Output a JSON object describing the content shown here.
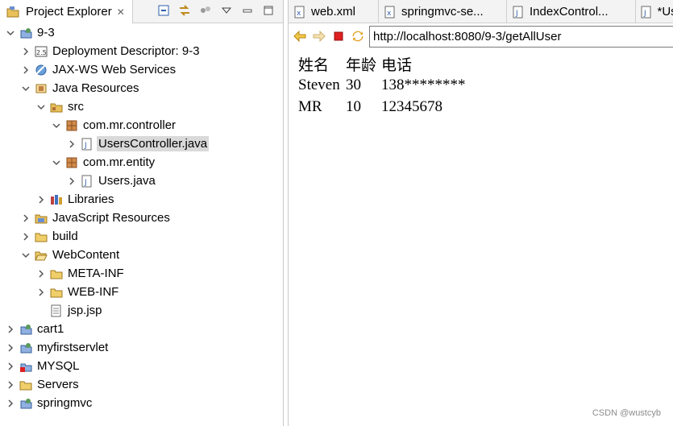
{
  "explorer": {
    "title": "Project Explorer",
    "close_glyph": "✕",
    "toolbar": [
      "collapse-all-icon",
      "link-with-editor-icon",
      "filter-icon",
      "view-menu-icon",
      "minimize-icon",
      "maximize-icon"
    ],
    "rows": [
      {
        "label": "9-3",
        "icon": "web-project-icon",
        "twisty": "expanded"
      },
      {
        "label": "Deployment Descriptor: 9-3",
        "icon": "deployment-descriptor-icon",
        "twisty": "collapsed"
      },
      {
        "label": "JAX-WS Web Services",
        "icon": "web-services-icon",
        "twisty": "collapsed"
      },
      {
        "label": "Java Resources",
        "icon": "java-resources-icon",
        "twisty": "expanded"
      },
      {
        "label": "src",
        "icon": "source-folder-icon",
        "twisty": "expanded"
      },
      {
        "label": "com.mr.controller",
        "icon": "package-icon",
        "twisty": "expanded"
      },
      {
        "label": "UsersController.java",
        "icon": "java-file-icon",
        "twisty": "collapsed",
        "selected": true
      },
      {
        "label": "com.mr.entity",
        "icon": "package-icon",
        "twisty": "expanded"
      },
      {
        "label": "Users.java",
        "icon": "java-file-icon",
        "twisty": "collapsed"
      },
      {
        "label": "Libraries",
        "icon": "libraries-icon",
        "twisty": "collapsed"
      },
      {
        "label": "JavaScript Resources",
        "icon": "javascript-resources-icon",
        "twisty": "collapsed"
      },
      {
        "label": "build",
        "icon": "folder-icon",
        "twisty": "collapsed"
      },
      {
        "label": "WebContent",
        "icon": "folder-open-icon",
        "twisty": "expanded"
      },
      {
        "label": "META-INF",
        "icon": "folder-icon",
        "twisty": "collapsed"
      },
      {
        "label": "WEB-INF",
        "icon": "folder-icon",
        "twisty": "collapsed"
      },
      {
        "label": "jsp.jsp",
        "icon": "jsp-file-icon",
        "twisty": "none"
      },
      {
        "label": "cart1",
        "icon": "web-project-icon",
        "twisty": "collapsed"
      },
      {
        "label": "myfirstservlet",
        "icon": "web-project-icon",
        "twisty": "collapsed"
      },
      {
        "label": "MYSQL",
        "icon": "web-project-error-icon",
        "twisty": "collapsed"
      },
      {
        "label": "Servers",
        "icon": "folder-icon",
        "twisty": "collapsed"
      },
      {
        "label": "springmvc",
        "icon": "web-project-icon",
        "twisty": "collapsed"
      }
    ]
  },
  "editor": {
    "tabs": [
      {
        "label": "web.xml",
        "icon": "xml-file-icon"
      },
      {
        "label": "springmvc-se...",
        "icon": "xml-file-icon"
      },
      {
        "label": "IndexControl...",
        "icon": "java-file-icon"
      },
      {
        "label": "*Use",
        "icon": "java-file-icon"
      }
    ]
  },
  "browser": {
    "nav": [
      "back-icon",
      "forward-icon",
      "stop-icon",
      "refresh-icon"
    ],
    "url": "http://localhost:8080/9-3/getAllUser",
    "table": {
      "headers": [
        "姓名",
        "年龄",
        "电话"
      ],
      "rows": [
        [
          "Steven",
          "30",
          "138********"
        ],
        [
          "MR",
          "10",
          "12345678"
        ]
      ]
    }
  },
  "watermark": "CSDN @wustcyb",
  "colors": {
    "selection": "#d9d9d9",
    "stop_red": "#e02020",
    "nav_arrow": "#e0a020",
    "package": "#b0703a"
  }
}
